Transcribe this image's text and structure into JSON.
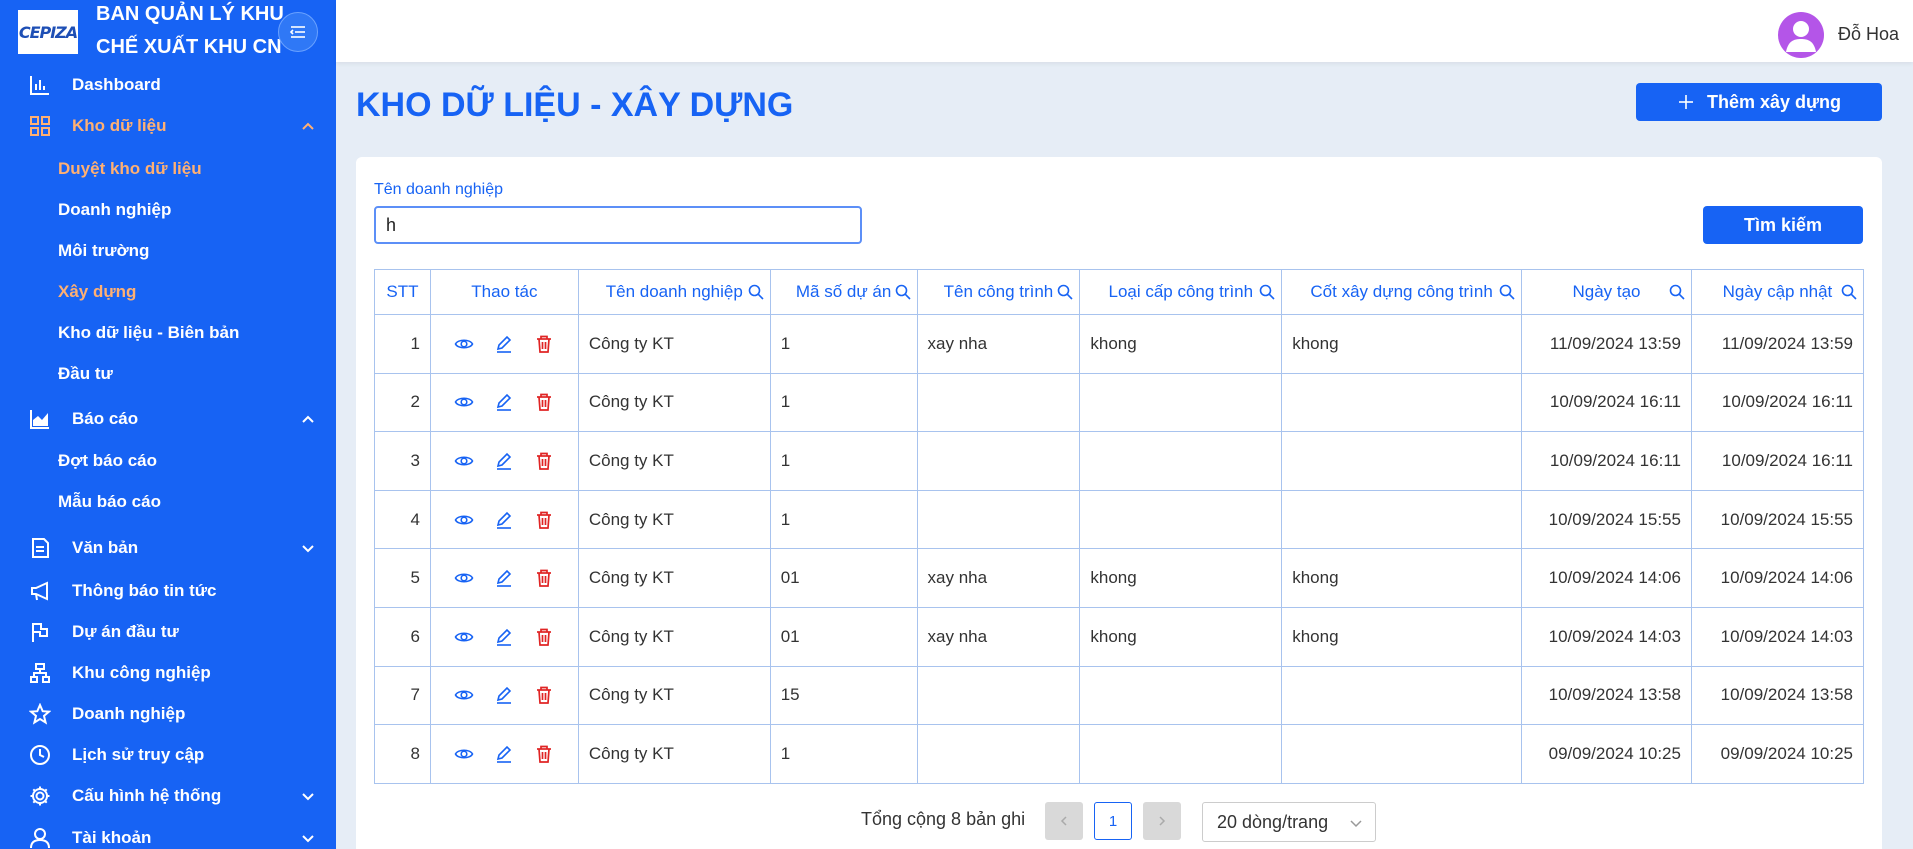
{
  "sidebar": {
    "logo_text": "CEPIZA",
    "brand_line1": "BAN QUẢN LÝ KHU",
    "brand_line2": "CHẾ XUẤT KHU CN",
    "items": [
      {
        "label": "Dashboard",
        "icon": "chart-bar-icon"
      },
      {
        "label": "Kho dữ liệu",
        "icon": "grid-icon"
      },
      {
        "label": "Báo cáo",
        "icon": "area-chart-icon"
      },
      {
        "label": "Văn bản",
        "icon": "document-icon"
      },
      {
        "label": "Thông báo tin tức",
        "icon": "megaphone-icon"
      },
      {
        "label": "Dự án đầu tư",
        "icon": "flag-icon"
      },
      {
        "label": "Khu công nghiệp",
        "icon": "sitemap-icon"
      },
      {
        "label": "Doanh nghiệp",
        "icon": "star-icon"
      },
      {
        "label": "Lịch sử truy cập",
        "icon": "clock-icon"
      },
      {
        "label": "Cấu hình hệ thống",
        "icon": "gear-icon"
      },
      {
        "label": "Tài khoản",
        "icon": "user-icon"
      }
    ],
    "kho_sub": [
      "Duyệt kho dữ liệu",
      "Doanh nghiệp",
      "Môi trường",
      "Xây dựng",
      "Kho dữ liệu - Biên bản",
      "Đầu tư"
    ],
    "baocao_sub": [
      "Đợt báo cáo",
      "Mẫu báo cáo"
    ],
    "active_color": "#ffb073",
    "bg_color": "#1763f4"
  },
  "header": {
    "user_name": "Đỗ Hoa"
  },
  "main": {
    "title": "KHO DỮ LIỆU - XÂY DỰNG",
    "add_button": "Thêm xây dựng",
    "search_label": "Tên doanh nghiệp",
    "search_value": "h",
    "search_button": "Tìm kiếm"
  },
  "table": {
    "headers": [
      "STT",
      "Thao tác",
      "Tên doanh nghiệp",
      "Mã số dự án",
      "Tên công trình",
      "Loại cấp công trình",
      "Cốt xây dựng công trình",
      "Ngày tạo",
      "Ngày cập nhật"
    ],
    "rows": [
      {
        "stt": "1",
        "company": "Công ty KT",
        "project_code": "1",
        "work_name": "xay nha",
        "level": "khong",
        "elevation": "khong",
        "created": "11/09/2024 13:59",
        "updated": "11/09/2024 13:59"
      },
      {
        "stt": "2",
        "company": "Công ty KT",
        "project_code": "1",
        "work_name": "",
        "level": "",
        "elevation": "",
        "created": "10/09/2024 16:11",
        "updated": "10/09/2024 16:11"
      },
      {
        "stt": "3",
        "company": "Công ty KT",
        "project_code": "1",
        "work_name": "",
        "level": "",
        "elevation": "",
        "created": "10/09/2024 16:11",
        "updated": "10/09/2024 16:11"
      },
      {
        "stt": "4",
        "company": "Công ty KT",
        "project_code": "1",
        "work_name": "",
        "level": "",
        "elevation": "",
        "created": "10/09/2024 15:55",
        "updated": "10/09/2024 15:55"
      },
      {
        "stt": "5",
        "company": "Công ty KT",
        "project_code": "01",
        "work_name": "xay nha",
        "level": "khong",
        "elevation": "khong",
        "created": "10/09/2024 14:06",
        "updated": "10/09/2024 14:06"
      },
      {
        "stt": "6",
        "company": "Công ty KT",
        "project_code": "01",
        "work_name": "xay nha",
        "level": "khong",
        "elevation": "khong",
        "created": "10/09/2024 14:03",
        "updated": "10/09/2024 14:03"
      },
      {
        "stt": "7",
        "company": "Công ty KT",
        "project_code": "15",
        "work_name": "",
        "level": "",
        "elevation": "",
        "created": "10/09/2024 13:58",
        "updated": "10/09/2024 13:58"
      },
      {
        "stt": "8",
        "company": "Công ty KT",
        "project_code": "1",
        "work_name": "",
        "level": "",
        "elevation": "",
        "created": "09/09/2024 10:25",
        "updated": "09/09/2024 10:25"
      }
    ]
  },
  "pagination": {
    "total_text": "Tổng cộng 8 bản ghi",
    "current_page": "1",
    "page_size": "20 dòng/trang"
  }
}
